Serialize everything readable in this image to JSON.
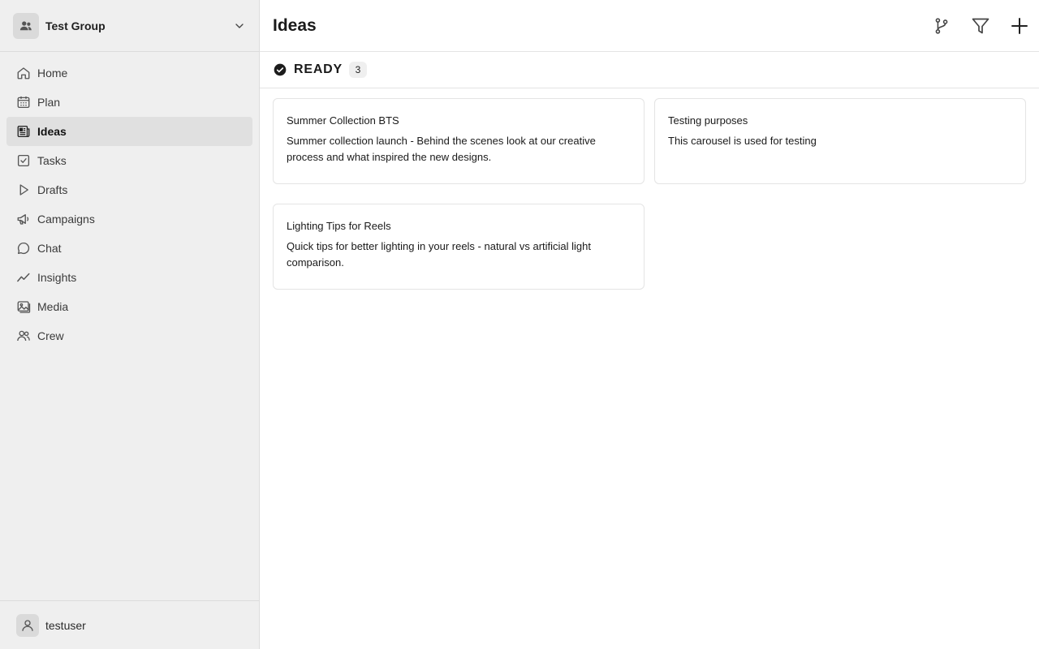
{
  "sidebar": {
    "group": {
      "name": "Test Group",
      "icon": "users-icon"
    },
    "items": [
      {
        "label": "Home",
        "icon": "home-icon",
        "active": false
      },
      {
        "label": "Plan",
        "icon": "calendar-icon",
        "active": false
      },
      {
        "label": "Ideas",
        "icon": "newspaper-icon",
        "active": true
      },
      {
        "label": "Tasks",
        "icon": "checkbox-icon",
        "active": false
      },
      {
        "label": "Drafts",
        "icon": "play-icon",
        "active": false
      },
      {
        "label": "Campaigns",
        "icon": "megaphone-icon",
        "active": false
      },
      {
        "label": "Chat",
        "icon": "chat-bubble-icon",
        "active": false
      },
      {
        "label": "Insights",
        "icon": "trend-line-icon",
        "active": false
      },
      {
        "label": "Media",
        "icon": "images-icon",
        "active": false
      },
      {
        "label": "Crew",
        "icon": "people-icon",
        "active": false
      }
    ],
    "user": {
      "name": "testuser",
      "icon": "user-icon"
    }
  },
  "header": {
    "title": "Ideas",
    "actions": [
      "branch-icon",
      "filter-icon",
      "plus-icon"
    ]
  },
  "section": {
    "title": "READY",
    "count": "3",
    "icon": "check-circle-icon"
  },
  "cards": [
    {
      "title": "Summer Collection BTS",
      "description": "Summer collection launch - Behind the scenes look at our creative process and what inspired the new designs."
    },
    {
      "title": "Testing purposes",
      "description": "This carousel is used for testing"
    },
    {
      "title": "Lighting Tips for Reels",
      "description": "Quick tips for better lighting in your reels - natural vs artificial light comparison."
    }
  ],
  "colors": {
    "sidebar_bg": "#efefef",
    "active_item_bg": "#e0e0e0",
    "border": "#e4e4e4",
    "text": "#1a1a1a"
  }
}
